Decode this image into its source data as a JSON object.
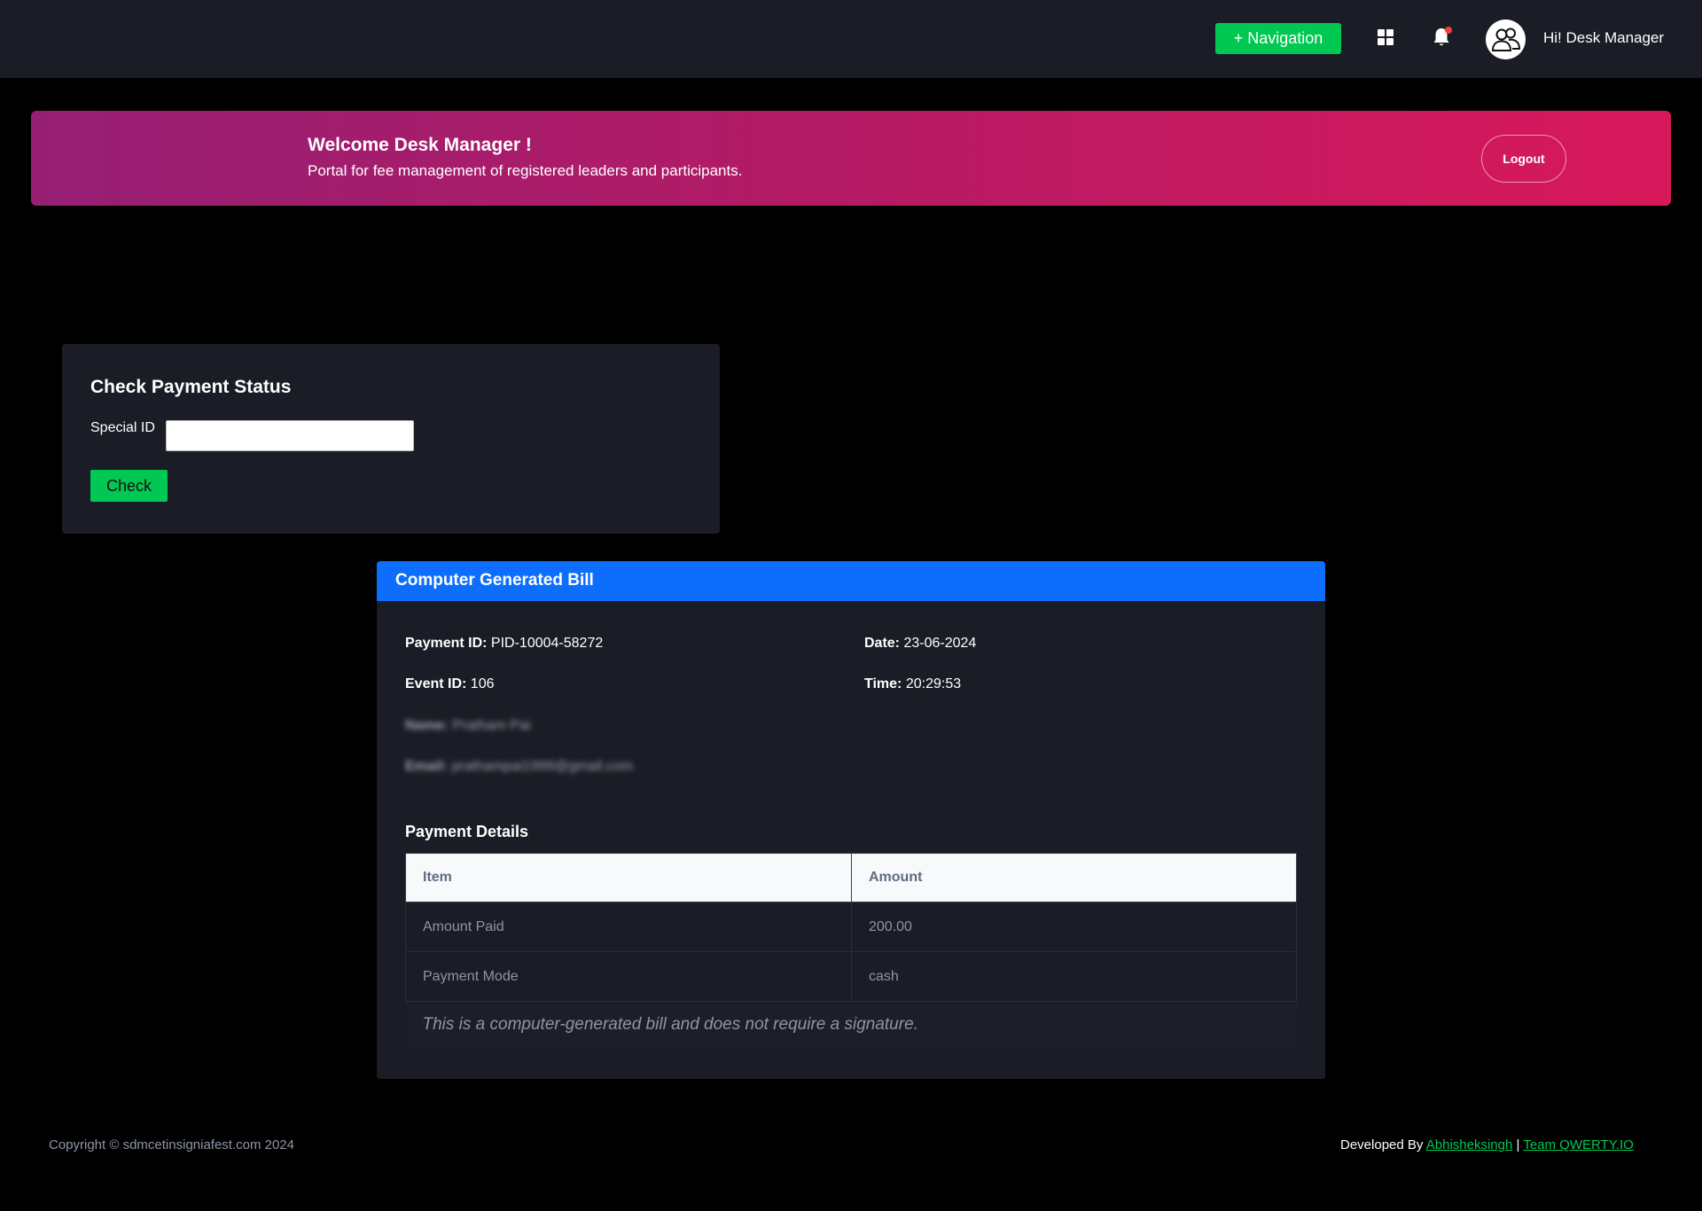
{
  "topbar": {
    "nav_button": "+ Navigation",
    "greeting": "Hi! Desk Manager",
    "notification_dot_color": "#ff3b3b"
  },
  "banner": {
    "title": "Welcome Desk Manager !",
    "subtitle": "Portal for fee management of registered leaders and participants.",
    "logout": "Logout"
  },
  "check_payment": {
    "title": "Check Payment Status",
    "label": "Special ID",
    "input_value": "",
    "button": "Check"
  },
  "bill": {
    "header": "Computer Generated Bill",
    "payment_id_label": "Payment ID:",
    "payment_id": "PID-10004-58272",
    "date_label": "Date:",
    "date": "23-06-2024",
    "event_id_label": "Event ID:",
    "event_id": "106",
    "time_label": "Time:",
    "time": "20:29:53",
    "name_label": "Name:",
    "name": "Pratham Pai",
    "email_label": "Email:",
    "email": "prathampai1999@gmail.com",
    "details_title": "Payment Details",
    "table": {
      "headers": [
        "Item",
        "Amount"
      ],
      "rows": [
        [
          "Amount Paid",
          "200.00"
        ],
        [
          "Payment Mode",
          "cash"
        ]
      ],
      "note": "This is a computer-generated bill and does not require a signature."
    }
  },
  "footer": {
    "copyright": "Copyright © sdmcetinsigniafest.com 2024",
    "developed_by": "Developed By",
    "author_link": "Abhisheksingh",
    "separator": "|",
    "team_link": "Team QWERTY.IO"
  },
  "colors": {
    "accent_green": "#00c853",
    "bill_header_blue": "#0d6efd",
    "banner_gradient_start": "#961f74",
    "banner_gradient_end": "#d8185a"
  }
}
